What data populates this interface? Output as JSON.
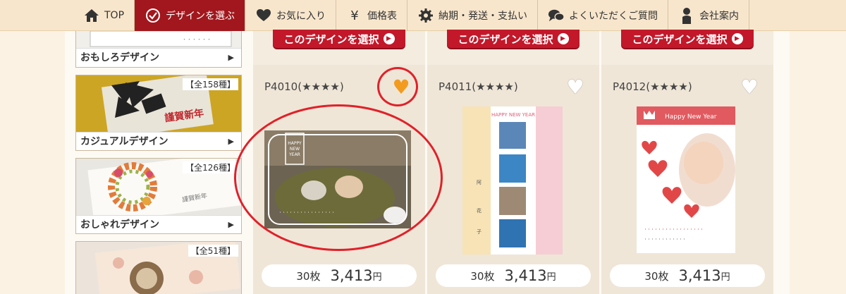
{
  "nav": {
    "items": [
      {
        "label": "TOP",
        "icon": "home-icon",
        "active": false
      },
      {
        "label": "デザインを選ぶ",
        "icon": "check-circle-icon",
        "active": true
      },
      {
        "label": "お気に入り",
        "icon": "heart-icon",
        "active": false
      },
      {
        "label": "価格表",
        "icon": "yen-icon",
        "active": false
      },
      {
        "label": "納期・発送・支払い",
        "icon": "gear-icon",
        "active": false
      },
      {
        "label": "よくいただくご質問",
        "icon": "chat-bubble-icon",
        "active": false
      },
      {
        "label": "会社案内",
        "icon": "person-icon",
        "active": false
      }
    ]
  },
  "sidebar": {
    "categories": [
      {
        "label": "おもしろデザイン",
        "count": ""
      },
      {
        "label": "カジュアルデザイン",
        "count": "【全158種】"
      },
      {
        "label": "おしゃれデザイン",
        "count": "【全126種】"
      },
      {
        "label": "",
        "count": "【全51種】"
      }
    ],
    "arrow": "▶"
  },
  "select_button": {
    "label": "このデザインを選択",
    "icon": "play-circle-icon"
  },
  "products": [
    {
      "code": "P4010(★★★★)",
      "favorite": true,
      "qty": "30枚",
      "price": "3,413",
      "yen": "円",
      "card_text": "HAPPY NEW YEAR"
    },
    {
      "code": "P4011(★★★★)",
      "favorite": false,
      "qty": "30枚",
      "price": "3,413",
      "yen": "円",
      "card_text": "HAPPY NEW YEAR"
    },
    {
      "code": "P4012(★★★★)",
      "favorite": false,
      "qty": "30枚",
      "price": "3,413",
      "yen": "円",
      "card_text": "Happy New Year"
    }
  ],
  "colors": {
    "accent": "#a1171d",
    "button": "#c3182a",
    "favorite": "#f39b1f",
    "annotation": "#e0212a"
  }
}
